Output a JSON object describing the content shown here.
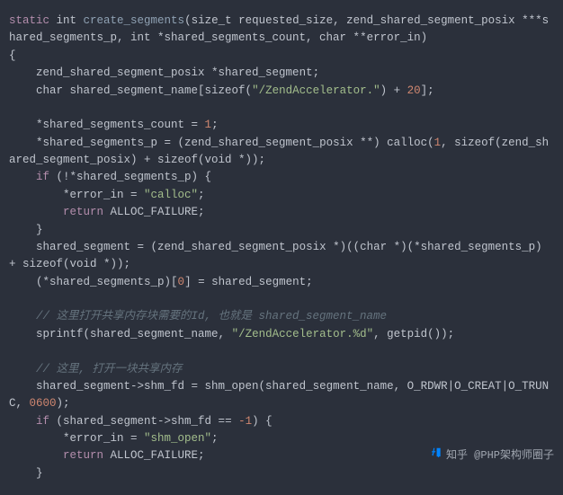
{
  "code": {
    "l1a": "static",
    "l1b": " int ",
    "l1c": "create_segments",
    "l1d": "(size_t requested_size, zend_shared_segment_posix ***shared_segments_p, int *shared_segments_count, char **error_in)",
    "l2": "{",
    "l3": "    zend_shared_segment_posix *shared_segment;",
    "l4a": "    char shared_segment_name[sizeof(",
    "l4b": "\"/ZendAccelerator.\"",
    "l4c": ") + ",
    "l4d": "20",
    "l4e": "];",
    "blank1": "",
    "l5a": "    *shared_segments_count = ",
    "l5b": "1",
    "l5c": ";",
    "l6a": "    *shared_segments_p = (zend_shared_segment_posix **) calloc(",
    "l6b": "1",
    "l6c": ", sizeof(zend_shared_segment_posix) + sizeof(void *));",
    "l7a": "    ",
    "l7b": "if",
    "l7c": " (!*shared_segments_p) {",
    "l8a": "        *error_in = ",
    "l8b": "\"calloc\"",
    "l8c": ";",
    "l9a": "        ",
    "l9b": "return",
    "l9c": " ALLOC_FAILURE;",
    "l10": "    }",
    "l11": "    shared_segment = (zend_shared_segment_posix *)((char *)(*shared_segments_p) + sizeof(void *));",
    "l12a": "    (*shared_segments_p)[",
    "l12b": "0",
    "l12c": "] = shared_segment;",
    "blank2": "",
    "c1": "    // 这里打开共享内存块需要的Id, 也就是 shared_segment_name",
    "l13a": "    sprintf(shared_segment_name, ",
    "l13b": "\"/ZendAccelerator.%d\"",
    "l13c": ", getpid());",
    "blank3": "",
    "c2": "    // 这里, 打开一块共享内存",
    "l14a": "    shared_segment->shm_fd = shm_open(shared_segment_name, O_RDWR|O_CREAT|O_TRUNC, ",
    "l14b": "0600",
    "l14c": ");",
    "l15a": "    ",
    "l15b": "if",
    "l15c": " (shared_segment->shm_fd == ",
    "l15d": "-1",
    "l15e": ") {",
    "l16a": "        *error_in = ",
    "l16b": "\"shm_open\"",
    "l16c": ";",
    "l17a": "        ",
    "l17b": "return",
    "l17c": " ALLOC_FAILURE;",
    "l18": "    }"
  },
  "watermark": "知乎 @PHP架构师圈子"
}
